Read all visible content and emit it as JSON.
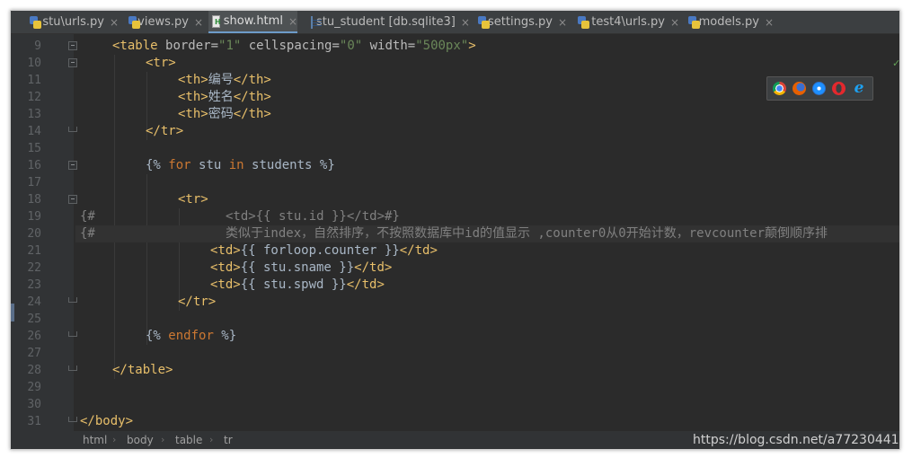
{
  "tabs": [
    {
      "label": "stu\\urls.py",
      "icon": "python-file-icon",
      "active": false
    },
    {
      "label": "views.py",
      "icon": "python-file-icon",
      "active": false
    },
    {
      "label": "show.html",
      "icon": "html-file-icon",
      "active": true
    },
    {
      "label": "stu_student [db.sqlite3]",
      "icon": "database-table-icon",
      "active": false
    },
    {
      "label": "settings.py",
      "icon": "python-file-icon",
      "active": false
    },
    {
      "label": "test4\\urls.py",
      "icon": "python-file-icon",
      "active": false
    },
    {
      "label": "models.py",
      "icon": "python-file-icon",
      "active": false
    }
  ],
  "close_glyph": "×",
  "line_numbers": [
    "9",
    "10",
    "11",
    "12",
    "13",
    "14",
    "15",
    "16",
    "17",
    "18",
    "19",
    "20",
    "21",
    "22",
    "23",
    "24",
    "25",
    "26",
    "27",
    "28",
    "29",
    "30",
    "31"
  ],
  "code": {
    "l9_open": "<table ",
    "l9_a1": "border=",
    "l9_v1": "\"1\"",
    "l9_a2": " cellspacing=",
    "l9_v2": "\"0\"",
    "l9_a3": " width=",
    "l9_v3": "\"500px\"",
    "l9_close": ">",
    "l10": "<tr>",
    "l11_open": "<th>",
    "l11_text": "编号",
    "l11_close": "</th>",
    "l12_open": "<th>",
    "l12_text": "姓名",
    "l12_close": "</th>",
    "l13_open": "<th>",
    "l13_text": "密码",
    "l13_close": "</th>",
    "l14": "</tr>",
    "l16_a": "{% ",
    "l16_for": "for",
    "l16_b": " stu ",
    "l16_in": "in",
    "l16_c": " students %}",
    "l18": "<tr>",
    "l19_prefix": "{#",
    "l19_body": "<td>{{ stu.id }}</td>#}",
    "l20_prefix": "{#",
    "l20_body": "类似于index，自然排序，不按照数据库中id的值显示 ,counter0从0开始计数，revcounter颠倒顺序排",
    "l21_open": "<td>",
    "l21_text": "{{ forloop.counter }}",
    "l21_close": "</td>",
    "l22_open": "<td>",
    "l22_text": "{{ stu.sname }}",
    "l22_close": "</td>",
    "l23_open": "<td>",
    "l23_text": "{{ stu.spwd }}",
    "l23_close": "</td>",
    "l24": "</tr>",
    "l26_a": "{% ",
    "l26_kw": "endfor",
    "l26_b": " %}",
    "l28": "</table>",
    "l31": "</body>"
  },
  "browsers": [
    "chrome-icon",
    "firefox-icon",
    "safari-icon",
    "opera-icon",
    "ie-icon"
  ],
  "breadcrumb": [
    "html",
    "body",
    "table",
    "tr"
  ],
  "breadcrumb_sep": "›",
  "watermark": "https://blog.csdn.net/a772304419",
  "inspection_mark": "✓",
  "colors": {
    "tag": "#e8bf6a",
    "string": "#6a8759",
    "keyword": "#cc7832",
    "comment": "#808080",
    "text": "#a9b7c6",
    "background": "#2b2b2b"
  }
}
